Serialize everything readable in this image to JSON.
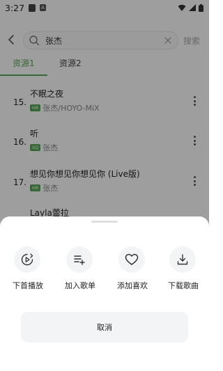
{
  "status_bar": {
    "time": "3:27"
  },
  "header": {
    "search_value": "张杰",
    "search_button": "搜索"
  },
  "tabs": [
    {
      "label": "资源1",
      "active": true
    },
    {
      "label": "资源2",
      "active": false
    }
  ],
  "songs": [
    {
      "index": "15.",
      "title": "不眠之夜",
      "quality": "HR",
      "artist": "张杰/HOYO-MiX"
    },
    {
      "index": "16.",
      "title": "听",
      "quality": "SQ",
      "artist": "张杰"
    },
    {
      "index": "17.",
      "title": "想见你想见你想见你 (Live版)",
      "quality": "HR",
      "artist": "张杰"
    },
    {
      "title": "Layla蕾拉"
    }
  ],
  "sheet": {
    "actions": [
      {
        "label": "下首播放",
        "icon": "play-next-icon"
      },
      {
        "label": "加入歌单",
        "icon": "playlist-add-icon"
      },
      {
        "label": "添加喜欢",
        "icon": "heart-icon"
      },
      {
        "label": "下载歌曲",
        "icon": "download-icon"
      }
    ],
    "cancel": "取消"
  },
  "colors": {
    "accent": "#57a857",
    "overlay": "rgba(0,0,0,0.38)",
    "sheet_bg": "#ffffff",
    "circle_bg": "#f3f4f6"
  }
}
